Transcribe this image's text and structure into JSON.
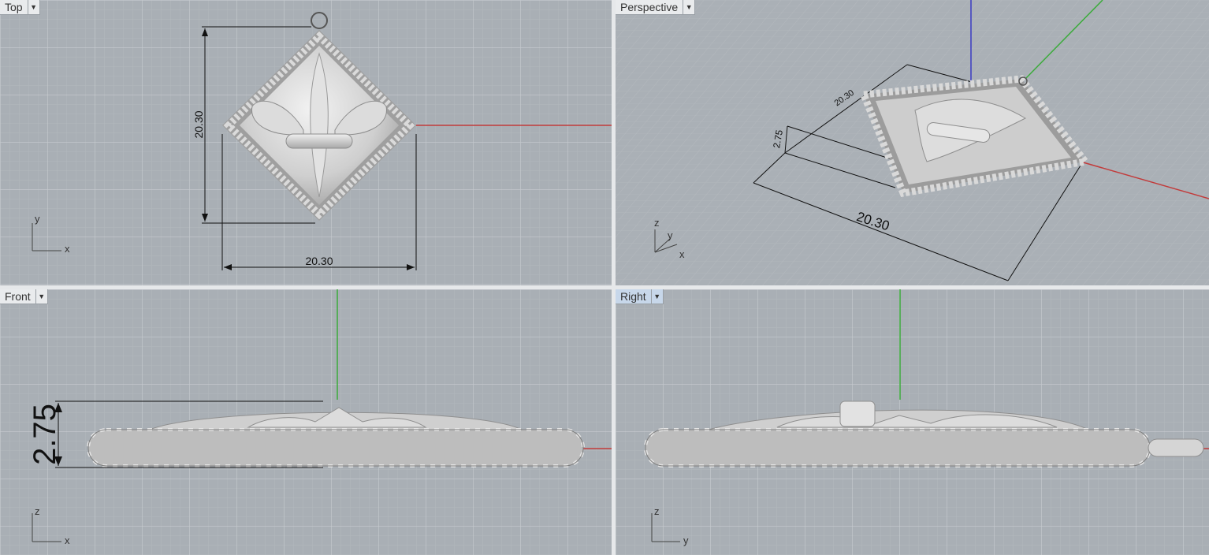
{
  "viewports": {
    "top": {
      "label": "Top",
      "dims": {
        "height": "20.30",
        "width": "20.30"
      },
      "axis": {
        "a": "y",
        "b": "x"
      }
    },
    "perspective": {
      "label": "Perspective",
      "dims": {
        "length": "20.30",
        "depth": "20.30",
        "height": "2.75"
      },
      "axis": {
        "a": "z",
        "b": "y",
        "c": "x"
      }
    },
    "front": {
      "label": "Front",
      "dims": {
        "height": "2.75"
      },
      "axis": {
        "a": "z",
        "b": "x"
      }
    },
    "right": {
      "label": "Right",
      "axis": {
        "a": "z",
        "b": "y"
      }
    }
  },
  "menu_icon": "dropdown-arrow-icon",
  "colors": {
    "grid_bg": "#a9afb5",
    "grid_minor": "#b3b8bd",
    "grid_major": "#c7cbcf",
    "x_axis": "#c23b3b",
    "y_axis": "#3bab3b",
    "z_axis": "#3b3bc2",
    "active_tab": "#c7d7ea"
  }
}
